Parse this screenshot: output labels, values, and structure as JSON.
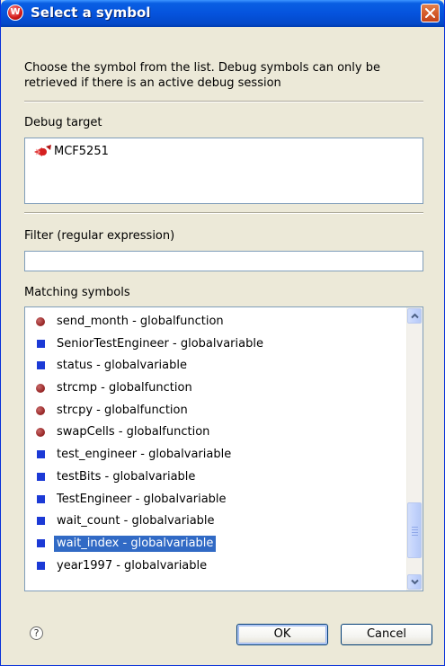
{
  "window": {
    "title": "Select a symbol",
    "app_icon": "windriver-icon",
    "close_icon": "close-icon"
  },
  "description": "Choose the symbol from the list.  Debug symbols can only be retrieved if there is an active debug session",
  "debug_target": {
    "label": "Debug target",
    "items": [
      {
        "label": "MCF5251",
        "icon": "debug-target-icon"
      }
    ]
  },
  "filter": {
    "label": "Filter (regular expression)",
    "value": "",
    "placeholder": ""
  },
  "matching_symbols": {
    "label": "Matching symbols",
    "items": [
      {
        "label": "send_month - globalfunction",
        "kind": "function"
      },
      {
        "label": "SeniorTestEngineer - globalvariable",
        "kind": "variable"
      },
      {
        "label": "status - globalvariable",
        "kind": "variable"
      },
      {
        "label": "strcmp - globalfunction",
        "kind": "function"
      },
      {
        "label": "strcpy - globalfunction",
        "kind": "function"
      },
      {
        "label": "swapCells - globalfunction",
        "kind": "function"
      },
      {
        "label": "test_engineer - globalvariable",
        "kind": "variable"
      },
      {
        "label": "testBits - globalvariable",
        "kind": "variable"
      },
      {
        "label": "TestEngineer - globalvariable",
        "kind": "variable"
      },
      {
        "label": "wait_count - globalvariable",
        "kind": "variable"
      },
      {
        "label": "wait_index - globalvariable",
        "kind": "variable",
        "selected": true
      },
      {
        "label": "year1997 - globalvariable",
        "kind": "variable"
      }
    ]
  },
  "buttons": {
    "ok": "OK",
    "cancel": "Cancel"
  },
  "colors": {
    "titlebar": "#0553dd",
    "selection": "#316ac5",
    "function_icon": "#9c2b2b",
    "variable_icon": "#1c3ad6",
    "dialog_bg": "#ece9d8"
  }
}
